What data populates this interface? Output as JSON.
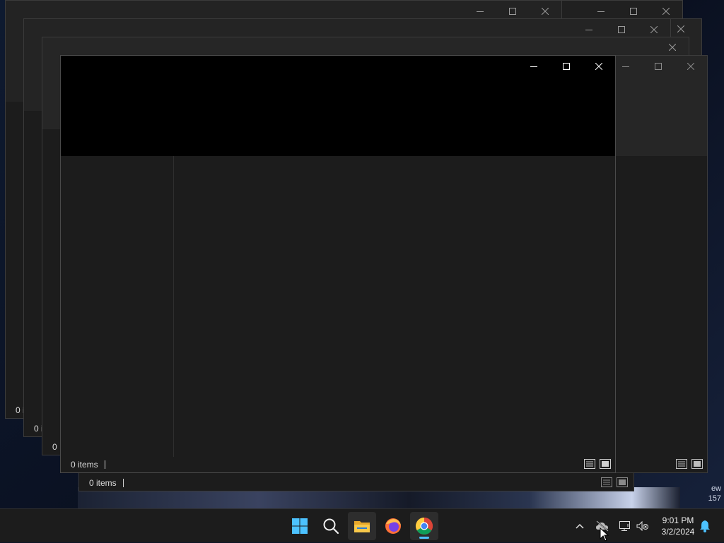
{
  "windows": {
    "status_text": "0 items",
    "partial_status_text": "0 items",
    "partial_status_text_2": "0"
  },
  "desktop": {
    "edge_text_1": "ew",
    "edge_text_2": "157"
  },
  "taskbar": {
    "apps": [
      "start-icon",
      "search-icon",
      "file-explorer-icon",
      "firefox-icon",
      "chrome-icon"
    ],
    "active_app": "chrome-icon",
    "clock": {
      "time": "9:01 PM",
      "date": "3/2/2024"
    }
  },
  "colors": {
    "accent": "#4cc2ff",
    "taskbar": "#1c1c1c",
    "window_body": "#1c1c1c",
    "front_header": "#000000"
  }
}
